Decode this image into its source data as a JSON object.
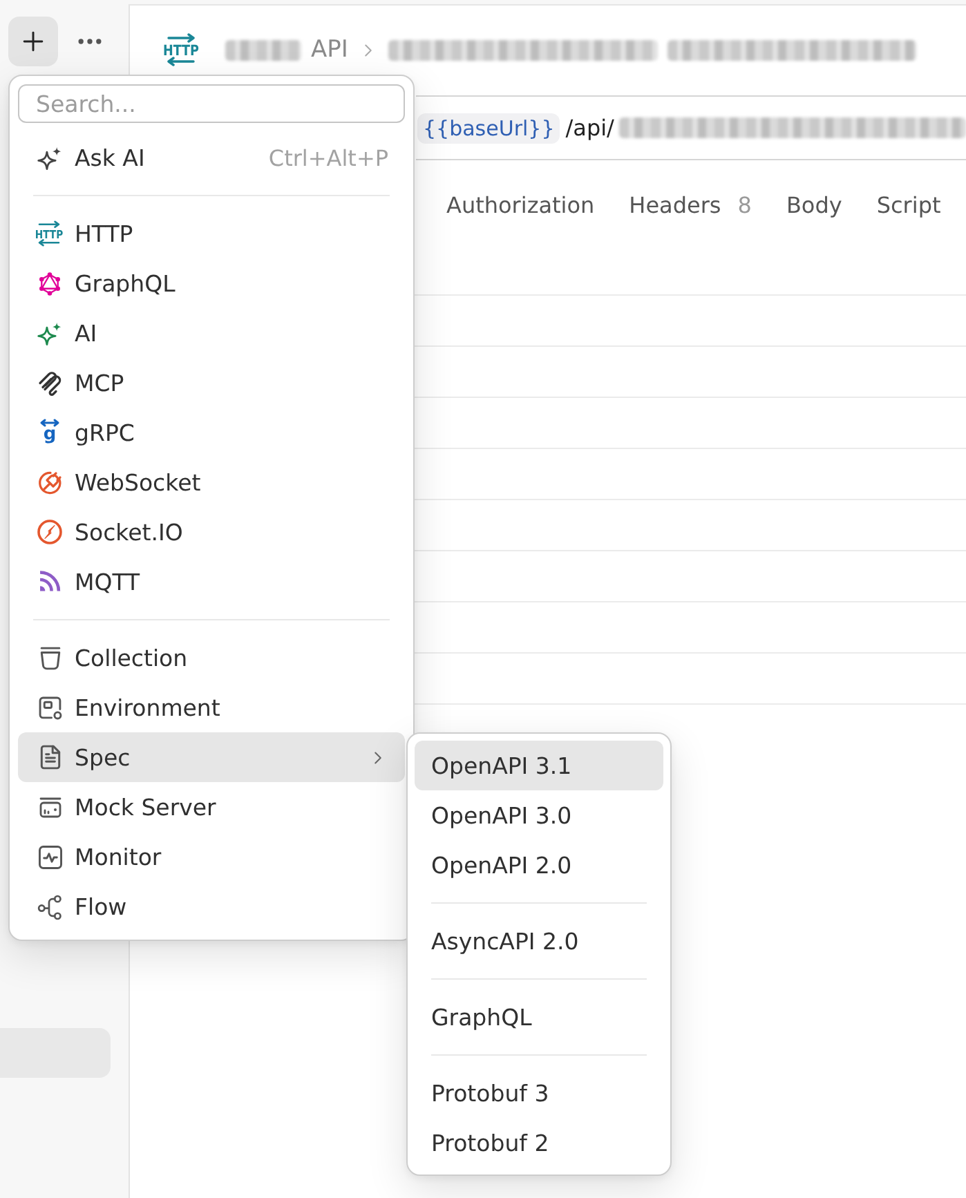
{
  "sidebar": {
    "add_button": {
      "active": true
    },
    "items": [
      {
        "selected": true
      }
    ]
  },
  "request": {
    "icon_text": "HTTP",
    "breadcrumb": [
      {
        "kind": "redacted"
      },
      {
        "kind": "text",
        "text": "API"
      },
      {
        "kind": "separator"
      },
      {
        "kind": "redacted"
      },
      {
        "kind": "redacted"
      }
    ],
    "url": {
      "variable": "{{baseUrl}}",
      "path": "/api/",
      "redacted_rest": true
    },
    "tabs": [
      {
        "label": "Authorization",
        "selected": false
      },
      {
        "label": "Headers",
        "count": "8",
        "selected": false
      },
      {
        "label": "Body",
        "selected": false
      },
      {
        "label": "Script",
        "selected": false
      }
    ]
  },
  "new_menu": {
    "search": {
      "placeholder": "Search..."
    },
    "sections": [
      {
        "items": [
          {
            "label": "Ask AI",
            "shortcut": "Ctrl+Alt+P",
            "selected": false
          }
        ]
      },
      {
        "items": [
          {
            "label": "HTTP",
            "icon_text": "HTTP",
            "selected": false
          },
          {
            "label": "GraphQL",
            "selected": false
          },
          {
            "label": "AI",
            "selected": false
          },
          {
            "label": "MCP",
            "selected": false
          },
          {
            "label": "gRPC",
            "icon_text": "g",
            "selected": false
          },
          {
            "label": "WebSocket",
            "selected": false
          },
          {
            "label": "Socket.IO",
            "selected": false
          },
          {
            "label": "MQTT",
            "selected": false
          }
        ]
      },
      {
        "items": [
          {
            "label": "Collection",
            "selected": false
          },
          {
            "label": "Environment",
            "selected": false
          },
          {
            "label": "Spec",
            "selected": true,
            "has_submenu": true
          },
          {
            "label": "Mock Server",
            "selected": false
          },
          {
            "label": "Monitor",
            "selected": false
          },
          {
            "label": "Flow",
            "selected": false
          }
        ]
      }
    ]
  },
  "submenu": {
    "sections": [
      {
        "items": [
          {
            "label": "OpenAPI 3.1",
            "selected": true
          },
          {
            "label": "OpenAPI 3.0",
            "selected": false
          },
          {
            "label": "OpenAPI 2.0",
            "selected": false
          }
        ]
      },
      {
        "items": [
          {
            "label": "AsyncAPI 2.0",
            "selected": false
          }
        ]
      },
      {
        "items": [
          {
            "label": "GraphQL",
            "selected": false
          }
        ]
      },
      {
        "items": [
          {
            "label": "Protobuf 3",
            "selected": false
          },
          {
            "label": "Protobuf 2",
            "selected": false
          }
        ]
      }
    ]
  }
}
